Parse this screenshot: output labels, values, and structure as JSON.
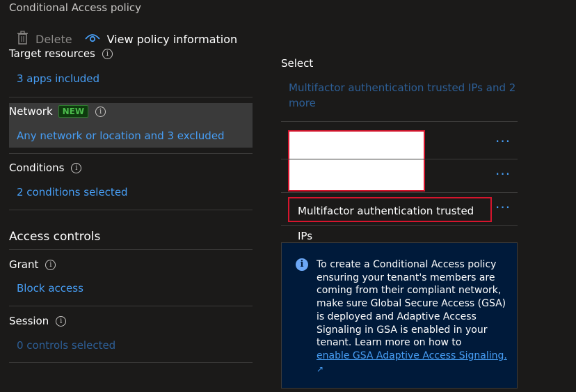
{
  "window": {
    "title": "Conditional Access policy"
  },
  "toolbar": {
    "delete_label": "Delete",
    "view_info_label": "View policy information"
  },
  "left": {
    "target_resources": {
      "label": "Target resources",
      "value": "3 apps included"
    },
    "network": {
      "label": "Network",
      "badge": "NEW",
      "value": "Any network or location and 3 excluded"
    },
    "conditions": {
      "label": "Conditions",
      "value": "2 conditions selected"
    },
    "access_controls": {
      "title": "Access controls"
    },
    "grant": {
      "label": "Grant",
      "value": "Block access"
    },
    "session": {
      "label": "Session",
      "value": "0 controls selected"
    }
  },
  "right": {
    "select_label": "Select",
    "selected_summary": "Multifactor authentication trusted IPs and 2 more",
    "items": [
      {
        "label": ""
      },
      {
        "label": ""
      },
      {
        "label": "Multifactor authentication trusted IPs"
      }
    ],
    "more_glyph": "···",
    "info": {
      "text": "To create a Conditional Access policy ensuring your tenant's members are coming from their compliant network, make sure Global Secure Access (GSA) is deployed and Adaptive Access Signaling in GSA is enabled in your tenant. Learn more on how to",
      "link": "enable GSA Adaptive Access Signaling."
    }
  }
}
